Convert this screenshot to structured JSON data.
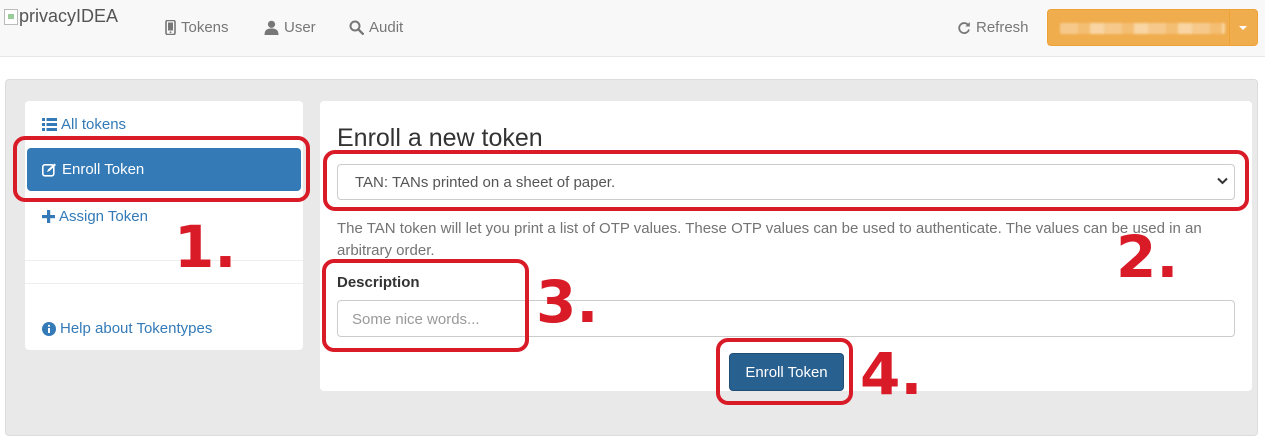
{
  "navbar": {
    "brand": "privacyIDEA",
    "links": [
      {
        "label": "Tokens",
        "icon": "mobile-icon"
      },
      {
        "label": "User",
        "icon": "user-icon"
      },
      {
        "label": "Audit",
        "icon": "search-icon"
      }
    ],
    "refresh": {
      "label": "Refresh",
      "icon": "refresh-icon"
    },
    "user_menu_color": "#f0ad4e"
  },
  "sidebar": {
    "items": [
      {
        "label": "All tokens",
        "icon": "list-icon"
      },
      {
        "label": "Enroll Token",
        "icon": "edit-icon",
        "active": true
      },
      {
        "label": "Assign Token",
        "icon": "plus-icon"
      },
      {
        "label": "Help about Tokentypes",
        "icon": "info-circle-icon"
      }
    ],
    "active_color": "#337ab7"
  },
  "enroll": {
    "title": "Enroll a new token",
    "token_type_selected": "TAN: TANs printed on a sheet of paper.",
    "description_text": "The TAN token will let you print a list of OTP values. These OTP values can be used to authenticate. The values can be used in an arbitrary order.",
    "description_label": "Description",
    "description_placeholder": "Some nice words...",
    "submit_label": "Enroll Token"
  },
  "annotations": {
    "color": "#d91a27",
    "markers": [
      "1.",
      "2.",
      "3.",
      "4."
    ]
  }
}
